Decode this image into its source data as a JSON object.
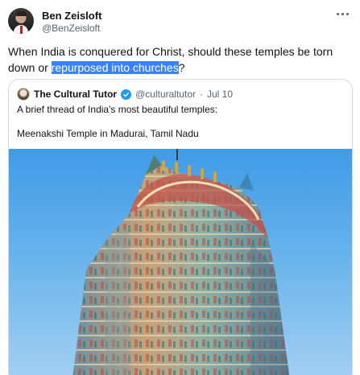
{
  "author": {
    "name": "Ben Zeisloft",
    "handle": "@BenZeisloft"
  },
  "tweet": {
    "text_before": "When India is conquered for Christ, should these temples be torn down or ",
    "text_selected": "repurposed into churches",
    "text_after": "?"
  },
  "quoted": {
    "name": "The Cultural Tutor",
    "handle": "@culturaltutor",
    "separator": "·",
    "date": "Jul 10",
    "line1": "A brief thread of India's most beautiful temples:",
    "line2": "Meenakshi Temple in Madurai, Tamil Nadu"
  },
  "colors": {
    "selection": "#3b82f6",
    "verified": "#1d9bf0",
    "secondary_text": "#536471",
    "sky": "#5aa9ea"
  },
  "icons": [
    "more-icon",
    "verified-badge-icon"
  ]
}
